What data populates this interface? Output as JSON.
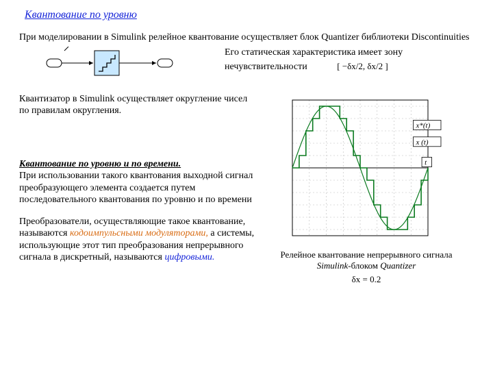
{
  "title": "Квантование по уровню",
  "p_intro": "При моделировании в Simulink  релейное квантование осуществляет блок Quantizer библиотеки Discontinuities",
  "static_char": "Его статическая характеристика имеет зону нечувствительности",
  "zone_expr": "[ −δx/2,  δx/2 ]",
  "p_round": "Квантизатор в Simulink осуществляет округление чисел по правилам округления.",
  "sub_title": "Квантование по уровню и по времени.",
  "p_sub_body": "При использовании такого квантования выходной сигнал преобразующего элемента создается путем последовательного квантования по уровню и по времени",
  "p_conv_a": "Преобразователи, осуществляющие такое квантование, называются ",
  "p_conv_orange": "кодоимпульсными модуляторами,",
  "p_conv_b": " а системы, использующие этот тип преобразования непрерывного сигнала в дискретный, называются ",
  "p_conv_blue": "цифровыми.",
  "chart_caption_a": "Релейное квантование непрерывного сигнала ",
  "chart_caption_it": "Simulink",
  "chart_caption_b": "-блоком ",
  "chart_caption_it2": "Quantizer",
  "delta_x": "δx = 0.2",
  "legend_xstar": "x*(t)",
  "legend_x": "x (t)",
  "legend_t": "t",
  "chart_data": {
    "type": "line",
    "title": "Релейное квантование непрерывного сигнала Simulink-блоком Quantizer (δx = 0.2)",
    "xlabel": "t",
    "ylabel": "",
    "xlim": [
      0,
      6.2832
    ],
    "ylim": [
      -1.1,
      1.1
    ],
    "series": [
      {
        "name": "x(t)",
        "kind": "continuous",
        "formula": "sin(t)",
        "x": [
          0,
          0.3142,
          0.6283,
          0.9425,
          1.2566,
          1.5708,
          1.885,
          2.1991,
          2.5133,
          2.8274,
          3.1416,
          3.4558,
          3.7699,
          4.0841,
          4.3982,
          4.7124,
          5.0265,
          5.3407,
          5.6549,
          5.969,
          6.2832
        ],
        "values": [
          0,
          0.309,
          0.588,
          0.809,
          0.951,
          1.0,
          0.951,
          0.809,
          0.588,
          0.309,
          0,
          -0.309,
          -0.588,
          -0.809,
          -0.951,
          -1.0,
          -0.951,
          -0.809,
          -0.588,
          -0.309,
          0
        ]
      },
      {
        "name": "x*(t)",
        "kind": "quantized-step",
        "quant_step": 0.2,
        "x": [
          0,
          0.3142,
          0.6283,
          0.9425,
          1.2566,
          1.5708,
          1.885,
          2.1991,
          2.5133,
          2.8274,
          3.1416,
          3.4558,
          3.7699,
          4.0841,
          4.3982,
          4.7124,
          5.0265,
          5.3407,
          5.6549,
          5.969,
          6.2832
        ],
        "values": [
          0,
          0.2,
          0.6,
          0.8,
          1.0,
          1.0,
          1.0,
          0.8,
          0.6,
          0.2,
          0,
          -0.2,
          -0.6,
          -0.8,
          -1.0,
          -1.0,
          -1.0,
          -0.8,
          -0.6,
          -0.2,
          0
        ]
      }
    ],
    "annotations": [
      {
        "text": "x*(t)",
        "x": 5.6,
        "y": 0.65,
        "box": true
      },
      {
        "text": "x (t)",
        "x": 5.6,
        "y": 0.38,
        "box": true
      },
      {
        "text": "t",
        "x": 6.0,
        "y": 0.05,
        "box": true
      }
    ]
  }
}
